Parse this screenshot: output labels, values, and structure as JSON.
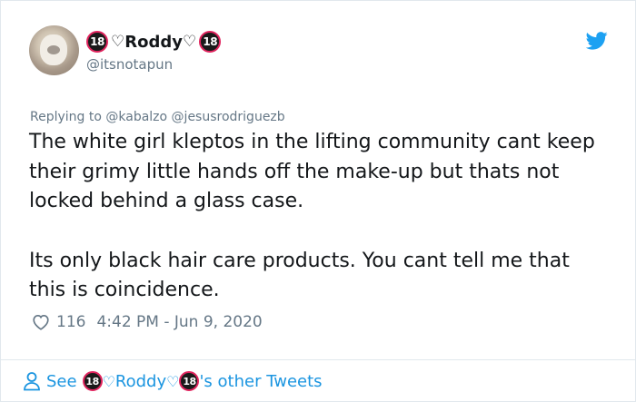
{
  "user": {
    "badge_left": "18",
    "name_prefix_heart": "♡",
    "name": "Roddy",
    "name_suffix_heart": "♡",
    "badge_right": "18",
    "handle": "@itsnotapun"
  },
  "reply": {
    "prefix": "Replying to",
    "mentions": "@kabalzo @jesusrodriguezb"
  },
  "tweet": {
    "paragraph1": "The white girl kleptos in the lifting community cant keep their grimy little hands off the make-up but thats not locked behind a glass case.",
    "paragraph2": "Its only black hair care products. You cant tell me that this is coincidence."
  },
  "meta": {
    "likes": "116",
    "timestamp": "4:42 PM - Jun 9, 2020"
  },
  "footer": {
    "see": "See",
    "badge_left": "18",
    "heart_left": "♡",
    "name": "Roddy",
    "heart_right": "♡",
    "badge_right": "18",
    "suffix": "'s other Tweets"
  },
  "colors": {
    "accent": "#1b95e0",
    "muted": "#657786",
    "text": "#14171a",
    "badge_ring": "#e0245e"
  },
  "icons": {
    "brand": "twitter-bird-icon",
    "like": "heart-icon",
    "profile": "person-icon"
  }
}
